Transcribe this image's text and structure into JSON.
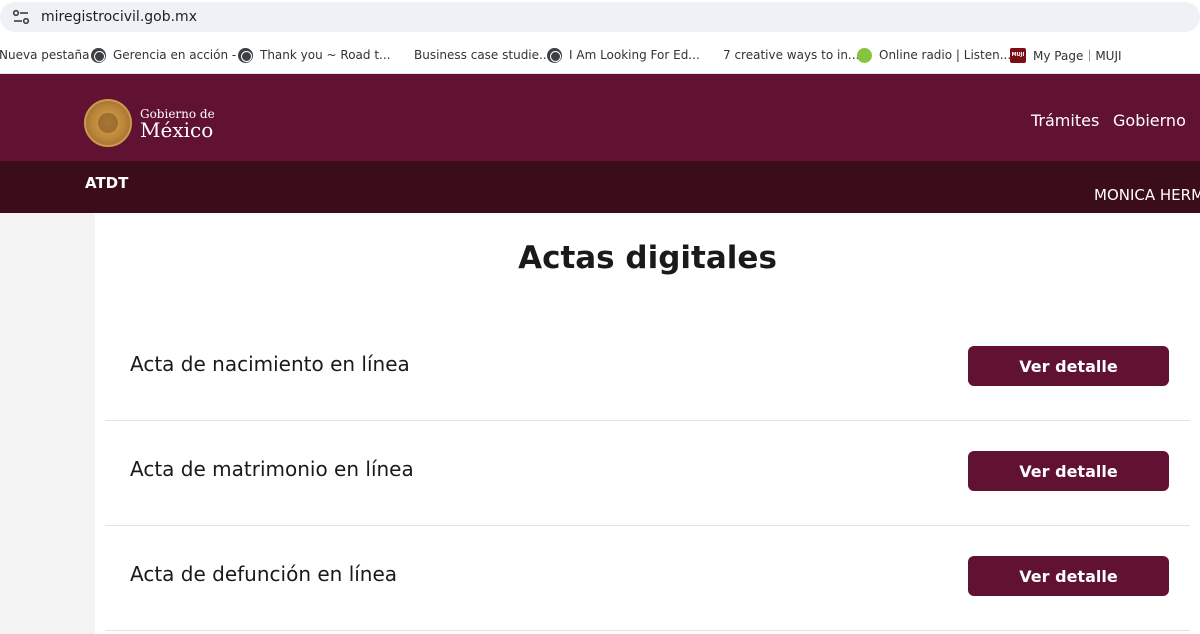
{
  "browser": {
    "url": "miregistrocivil.gob.mx",
    "bookmarks": [
      {
        "label": "Nueva pestaña",
        "icon": "none"
      },
      {
        "label": "Gerencia en acción -",
        "icon": "globe-icon"
      },
      {
        "label": "Thank you ~ Road t...",
        "icon": "globe-icon"
      },
      {
        "label": "Business case studie...",
        "icon": "none"
      },
      {
        "label": "I Am Looking For Ed...",
        "icon": "globe-icon"
      },
      {
        "label": "7 creative ways to in...",
        "icon": "none"
      },
      {
        "label": "Online radio | Listen...",
        "icon": "leaf-icon"
      },
      {
        "label": "My Page｜MUJI",
        "icon": "muji-icon",
        "icon_text": "MUJI"
      }
    ]
  },
  "header": {
    "logo_small": "Gobierno de",
    "logo_big": "México",
    "nav": [
      "Trámites",
      "Gobierno"
    ],
    "section": "ATDT",
    "user": "MONICA HERM"
  },
  "main": {
    "title": "Actas digitales",
    "actas": [
      {
        "label": "Acta de nacimiento en línea",
        "button": "Ver detalle"
      },
      {
        "label": "Acta de matrimonio en línea",
        "button": "Ver detalle"
      },
      {
        "label": "Acta de defunción en línea",
        "button": "Ver detalle"
      }
    ]
  },
  "colors": {
    "brand": "#611232",
    "brand_dark": "#3b0d19"
  }
}
